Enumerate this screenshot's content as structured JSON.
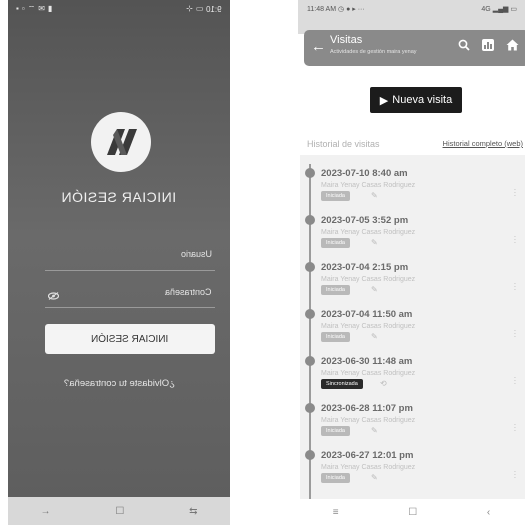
{
  "left_screen": {
    "status_right": "9:10",
    "title": "INICIAR SESIÓN",
    "username_label": "Usuario",
    "password_label": "Contraseña",
    "login_button": "INICIAR SESIÓN",
    "forgot_password": "¿Olvidaste tu contraseña?",
    "nav": {
      "back": "→",
      "home": "☐",
      "recents": "⇆"
    }
  },
  "right_screen": {
    "status_time": "11:48 AM",
    "status_right": "4G",
    "appbar": {
      "title": "Visitas",
      "subtitle": "Actividades de gestión maira yenay"
    },
    "new_visit_button": "Nueva visita",
    "history_label": "Historial de visitas",
    "full_history_link": "Historial completo (web)",
    "visits": [
      {
        "date": "2023-07-10 8:40 am",
        "person": "Maira Yenay Casas Rodriguez",
        "status": "Iniciada",
        "status_style": "light"
      },
      {
        "date": "2023-07-05 3:52 pm",
        "person": "Maira Yenay Casas Rodriguez",
        "status": "Iniciada",
        "status_style": "light"
      },
      {
        "date": "2023-07-04 2:15 pm",
        "person": "Maira Yenay Casas Rodriguez",
        "status": "Iniciada",
        "status_style": "light"
      },
      {
        "date": "2023-07-04 11:50 am",
        "person": "Maira Yenay Casas Rodriguez",
        "status": "Iniciada",
        "status_style": "light"
      },
      {
        "date": "2023-06-30 11:48 am",
        "person": "Maira Yenay Casas Rodriguez",
        "status": "Sincronizada",
        "status_style": "dark"
      },
      {
        "date": "2023-06-28 11:07 pm",
        "person": "Maira Yenay Casas Rodriguez",
        "status": "Iniciada",
        "status_style": "light"
      },
      {
        "date": "2023-06-27 12:01 pm",
        "person": "Maira Yenay Casas Rodriguez",
        "status": "Iniciada",
        "status_style": "light"
      }
    ],
    "nav": {
      "recents": "≡",
      "home": "☐",
      "back": "‹"
    }
  },
  "colors": {
    "appbar": "#8a8a8a",
    "button_dark": "#1c1c1c",
    "login_bg": "#5e5e5e"
  }
}
